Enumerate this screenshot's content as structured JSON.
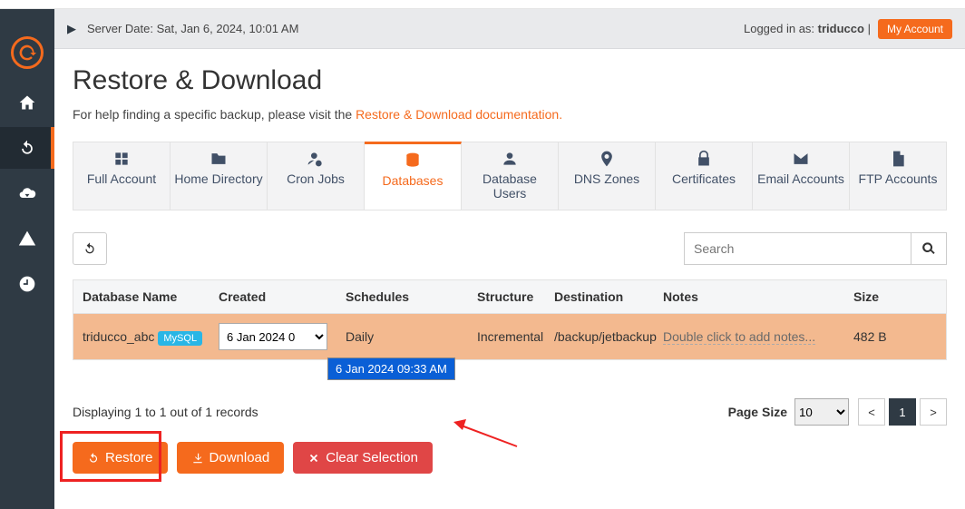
{
  "topbar": {
    "server_date_label": "Server Date: Sat, Jan 6, 2024, 10:01 AM",
    "logged_in_prefix": "Logged in as: ",
    "username": "triducco",
    "my_account": "My Account"
  },
  "page": {
    "title": "Restore & Download",
    "help_prefix": "For help finding a specific backup, please visit the ",
    "help_link": "Restore & Download documentation."
  },
  "tabs": [
    {
      "label": "Full Account"
    },
    {
      "label": "Home Directory"
    },
    {
      "label": "Cron Jobs"
    },
    {
      "label": "Databases",
      "active": true
    },
    {
      "label": "Database Users"
    },
    {
      "label": "DNS Zones"
    },
    {
      "label": "Certificates"
    },
    {
      "label": "Email Accounts"
    },
    {
      "label": "FTP Accounts"
    }
  ],
  "search": {
    "placeholder": "Search"
  },
  "table": {
    "headers": {
      "db": "Database Name",
      "created": "Created",
      "schedules": "Schedules",
      "structure": "Structure",
      "destination": "Destination",
      "notes": "Notes",
      "size": "Size"
    },
    "row": {
      "db_name": "triducco_abc",
      "db_engine": "MySQL",
      "created_selected": "6 Jan 2024 0",
      "created_option": "6 Jan 2024 09:33 AM",
      "schedules": "Daily",
      "structure": "Incremental",
      "destination": "/backup/jetbackup",
      "notes": "Double click to add notes...",
      "size": "482 B"
    }
  },
  "footer": {
    "records_text": "Displaying 1 to 1 out of 1 records",
    "page_size_label": "Page Size",
    "page_size_value": "10",
    "page_current": "1",
    "prev": "<",
    "next": ">"
  },
  "actions": {
    "restore": "Restore",
    "download": "Download",
    "clear": "Clear Selection"
  }
}
